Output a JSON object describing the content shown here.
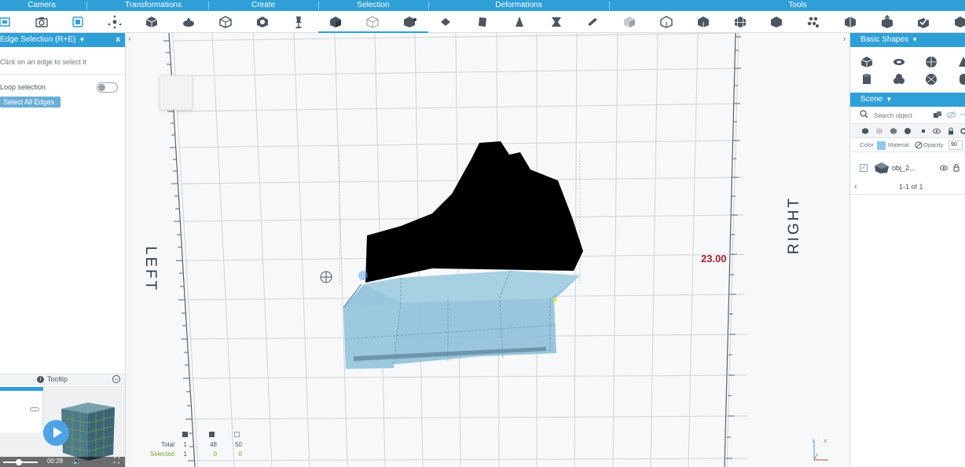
{
  "toolbar": {
    "categories": [
      {
        "label": "Camera"
      },
      {
        "label": "Transformations"
      },
      {
        "label": "Create"
      },
      {
        "label": "Selection"
      },
      {
        "label": "Deformations"
      },
      {
        "label": "Tools"
      }
    ],
    "accent_color": "#2f9fd8"
  },
  "left_panel": {
    "title": "Edge Selection (R+E)",
    "close_label": "x",
    "hint": "Click on an edge to select it",
    "loop_label": "Loop selection",
    "loop_enabled": false,
    "select_all_label": "Select All Edges"
  },
  "tooltip": {
    "title": "Tooltip",
    "info_label": "i",
    "minimize_label": "−",
    "video": {
      "time": "00:28",
      "fullscreen_label": "⛶",
      "volume_label": "🔈"
    }
  },
  "viewport": {
    "left_label": "LEFT",
    "right_label": "RIGHT",
    "dimension_value": "23.00",
    "dimension_color": "#a8202e",
    "mesh_color": "#8ec0d8",
    "stats": {
      "total_label": "Total",
      "selected_label": "Selected",
      "total": [
        "1",
        "48",
        "50"
      ],
      "selected": [
        "1",
        "0",
        "0"
      ]
    },
    "gizmo_labels": {
      "y": "Y",
      "x": "X"
    }
  },
  "right_panel": {
    "basic_shapes_title": "Basic Shapes",
    "scene_title": "Scene",
    "search_placeholder": "Search object",
    "color_label": "Color",
    "material_label": "Material",
    "opacity_label": "Opacity",
    "opacity_value": "90",
    "object_name": "obj_2...",
    "pager_text": "1-1 of 1",
    "prev_label": "‹"
  }
}
